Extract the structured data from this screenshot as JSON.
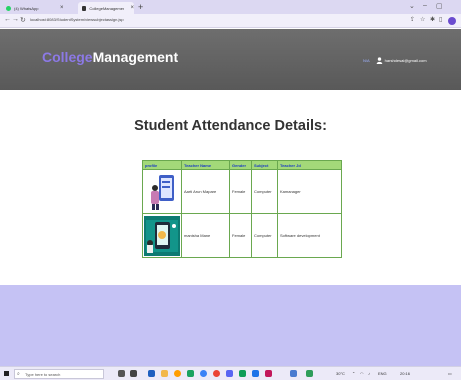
{
  "browser": {
    "tabs": [
      {
        "label": "(4) WhatsApp",
        "active": false,
        "favicon_color": "#25d366"
      },
      {
        "label": "CollegeManagement",
        "active": true,
        "favicon_color": "#333333"
      }
    ],
    "new_tab": "+",
    "url": "localhost:8083/StudentSystem/viewsubjectassign.jsp"
  },
  "header": {
    "brand_part1": "College",
    "brand_part2": "Management",
    "user_link": "N/A",
    "user_email": "harshdesai@gmail.com",
    "accent": "#8c79e6"
  },
  "main": {
    "title": "Student Attendance Details:",
    "table": {
      "headers": [
        "profile",
        "Teacher Name",
        "Gender",
        "Subject",
        "Teacher Jd"
      ],
      "rows": [
        {
          "name": "Aarti Arun Mapare",
          "gender": "Female",
          "subject": "Computer",
          "jd": "Kamanager"
        },
        {
          "name": "manisha Mane",
          "gender": "Female",
          "subject": "Computer",
          "jd": "Software development"
        }
      ]
    }
  },
  "taskbar": {
    "search_placeholder": "Type here to search",
    "tray_temp": "30°C",
    "tray_lang": "ENG",
    "tray_time": "20:16"
  }
}
